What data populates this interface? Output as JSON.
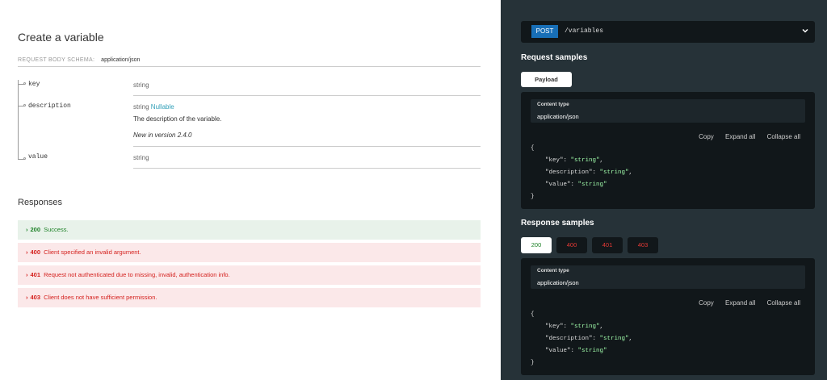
{
  "left": {
    "title": "Create a variable",
    "schema_label": "REQUEST BODY SCHEMA:",
    "schema_type": "application/json",
    "properties": [
      {
        "name": "key",
        "type": "string"
      },
      {
        "name": "description",
        "type": "string",
        "nullable": "Nullable",
        "desc": "The description of the variable.",
        "note": "New in version 2.4.0"
      },
      {
        "name": "value",
        "type": "string"
      }
    ],
    "responses_title": "Responses",
    "responses": [
      {
        "code": "200",
        "text": "Success."
      },
      {
        "code": "400",
        "text": "Client specified an invalid argument."
      },
      {
        "code": "401",
        "text": "Request not authenticated due to missing, invalid, authentication info."
      },
      {
        "code": "403",
        "text": "Client does not have sufficient permission."
      }
    ]
  },
  "right": {
    "method": "POST",
    "path": "/variables",
    "request_title": "Request samples",
    "payload_tab": "Payload",
    "response_title": "Response samples",
    "response_tabs": [
      "200",
      "400",
      "401",
      "403"
    ],
    "content_type_label": "Content type",
    "content_type_value": "application/json",
    "actions": {
      "copy": "Copy",
      "expand": "Expand all",
      "collapse": "Collapse all"
    },
    "json": {
      "open": "{",
      "close": "}",
      "lines": [
        {
          "key": "\"key\"",
          "val": "\"string\"",
          "comma": ","
        },
        {
          "key": "\"description\"",
          "val": "\"string\"",
          "comma": ","
        },
        {
          "key": "\"value\"",
          "val": "\"string\"",
          "comma": ""
        }
      ]
    }
  },
  "colors": {
    "method_post": "#186fb7",
    "success": "#1d8127",
    "error": "#d41f1c",
    "nullable": "#32a0b8",
    "json_string": "#a0fbaa",
    "panel_bg": "#263238"
  }
}
